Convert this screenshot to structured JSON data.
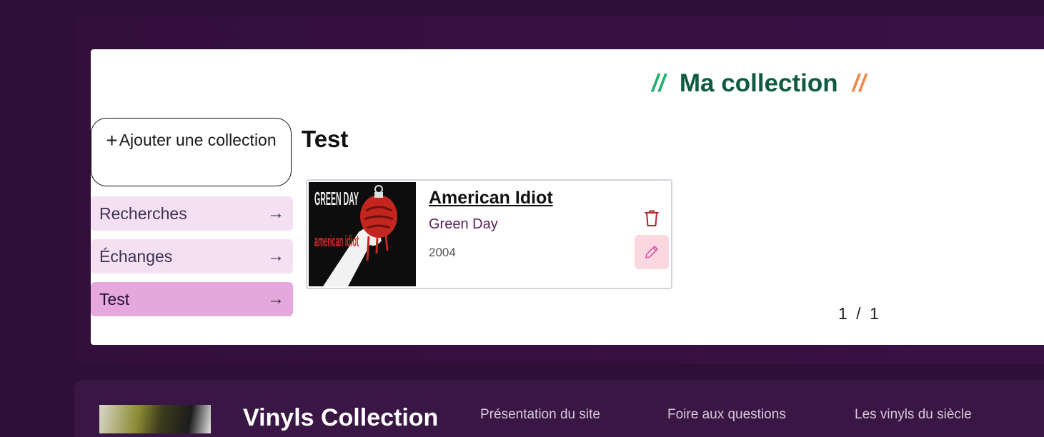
{
  "header": {
    "title": "Ma collection",
    "slash_left": "//",
    "slash_right": "//"
  },
  "sidebar": {
    "add_button_plus": "+",
    "add_button_label": "Ajouter une collection",
    "items": [
      {
        "label": "Recherches",
        "arrow": "→"
      },
      {
        "label": "Échanges",
        "arrow": "→"
      },
      {
        "label": "Test",
        "arrow": "→",
        "active": true
      }
    ]
  },
  "main": {
    "collection_name": "Test",
    "albums": [
      {
        "title": "American Idiot",
        "artist": "Green Day",
        "year": "2004",
        "cover_text_top": "GREEN DAY",
        "cover_text_bottom": "american idiot"
      }
    ],
    "pagination": "1 / 1"
  },
  "footer": {
    "brand": "Vinyls Collection",
    "links": [
      "Présentation du site",
      "Foire aux questions",
      "Les vinyls du siècle"
    ]
  },
  "colors": {
    "accent_green": "#0f5a40",
    "slash_green": "#22b06e",
    "slash_orange": "#f08a4b",
    "active_item": "#e6a7dc",
    "inactive_item": "#f5dff3",
    "edit_button_bg": "#fbd8df",
    "trash_color": "#b3262e",
    "pencil_color": "#d656a8"
  },
  "icons": {
    "add": "plus-icon",
    "nav_arrow": "arrow-right-icon",
    "delete": "trash-icon",
    "edit": "pencil-icon"
  }
}
